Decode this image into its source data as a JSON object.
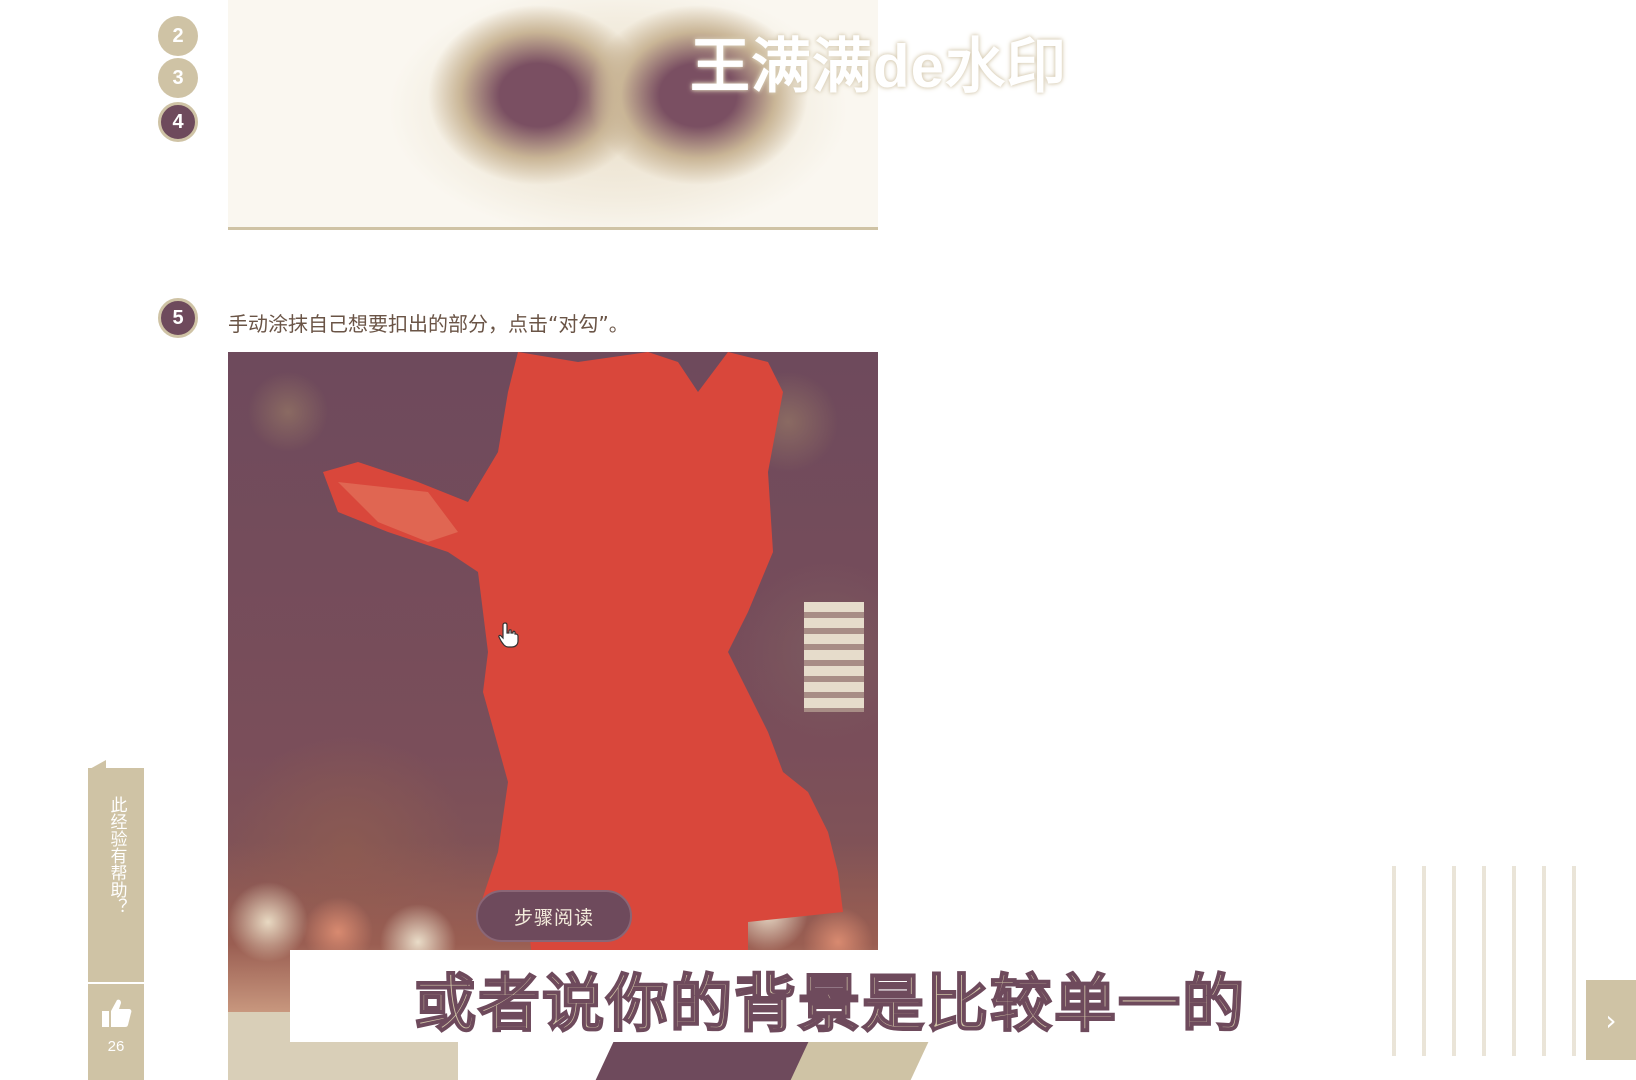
{
  "steps": {
    "step2": {
      "number": "2"
    },
    "step3": {
      "number": "3"
    },
    "step4": {
      "number": "4"
    },
    "step5": {
      "number": "5",
      "text": "手动涂抹自己想要扣出的部分，点击“对勾”。"
    }
  },
  "watermark": "王满满de水印",
  "floating_button": {
    "label": "步骤阅读"
  },
  "subtitle": "或者说你的背景是比较单一的",
  "feedback": {
    "question": "此经验有帮助？",
    "like_count": "26"
  },
  "icons": {
    "cursor": "hand-pointer-icon",
    "like": "thumbs-up-icon",
    "next": "chevron-right-icon"
  },
  "colors": {
    "accent_plum": "#6e4a5c",
    "accent_tan": "#cfc3a5",
    "selection_red": "#d9473b"
  }
}
